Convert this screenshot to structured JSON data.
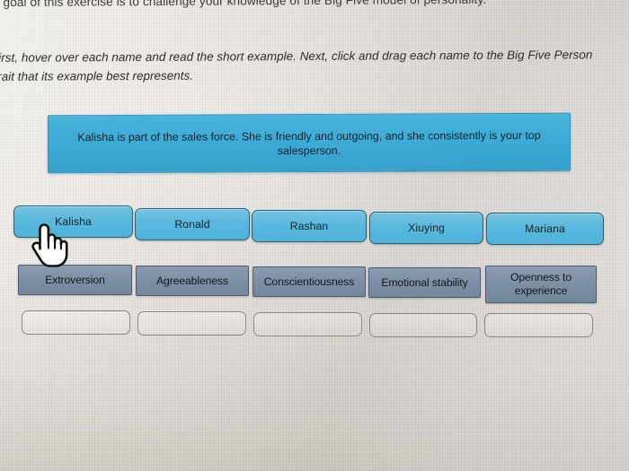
{
  "page": {
    "goal_line": "e goal of this exercise is to challenge your knowledge of the Big Five model of personality.",
    "instruction_line_1": "First, hover over each name and read the short example. Next, click and drag each name to the Big Five Person",
    "instruction_line_2": "Trait that its example best represents."
  },
  "tooltip": {
    "text": "Kalisha is part of the sales force. She is friendly and outgoing, and she consistently is your top salesperson.",
    "color": "#3aa9d4"
  },
  "names": {
    "color": "#5cb9dd",
    "items": [
      {
        "label": "Kalisha"
      },
      {
        "label": "Ronald"
      },
      {
        "label": "Rashan"
      },
      {
        "label": "Xiuying"
      },
      {
        "label": "Mariana"
      }
    ]
  },
  "traits": {
    "color": "#7d8fa6",
    "items": [
      {
        "label": "Extroversion"
      },
      {
        "label": "Agreeableness"
      },
      {
        "label": "Conscientiousness"
      },
      {
        "label": "Emotional stability"
      },
      {
        "label": "Openness to experience"
      }
    ]
  },
  "drop_zones": [
    {
      "value": ""
    },
    {
      "value": ""
    },
    {
      "value": ""
    },
    {
      "value": ""
    },
    {
      "value": ""
    }
  ],
  "cursor": {
    "icon": "pointing-hand-cursor"
  }
}
